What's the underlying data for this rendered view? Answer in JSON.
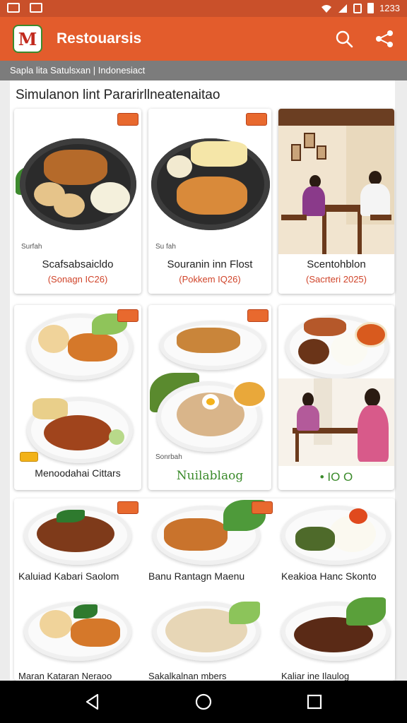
{
  "status": {
    "time": "1233"
  },
  "app": {
    "title": "Restouarsis",
    "logo_text": "M"
  },
  "subheader": {
    "text": "Sapla lita Satulsxan | Indonesiact"
  },
  "section": {
    "title": "Simulanon lint Pararirllneatenaitao"
  },
  "cards": [
    {
      "small_label": "Surfah",
      "title": "Scafsabsaicldo",
      "subtitle": "(Sonagn IC26)"
    },
    {
      "small_label": "Su fah",
      "title": "Souranin inn Flost",
      "subtitle": "(Pokkem IQ26)"
    },
    {
      "title": "Scentohblon",
      "subtitle": "(Sacrteri 2025)"
    },
    {
      "title": "Menoodahai Cittars"
    },
    {
      "small_label": "Sonrbah",
      "title": "Nuilablaog"
    },
    {
      "title": "• IO O"
    }
  ],
  "dishes": [
    {
      "name": "Kaluiad Kabari Saolom"
    },
    {
      "name": "Banu Rantagn Maenu"
    },
    {
      "name": "Keakioa Hanc Skonto"
    },
    {
      "name": "Maran Kataran Neraoo"
    },
    {
      "name": "Sakalkalnan mbers"
    },
    {
      "name": "Kaliar ine Ilaulog"
    }
  ],
  "icons": [
    "email-icon",
    "gmail-icon",
    "wifi-icon",
    "signal-icon",
    "battery-icon",
    "search-icon",
    "share-icon",
    "back-icon",
    "home-icon",
    "recents-icon"
  ],
  "colors": {
    "appbar": "#e35c2c",
    "statusbar": "#c9502a",
    "subheader": "#7c7c7c",
    "accent_red": "#d0442a",
    "green_text": "#3a8a2a"
  }
}
